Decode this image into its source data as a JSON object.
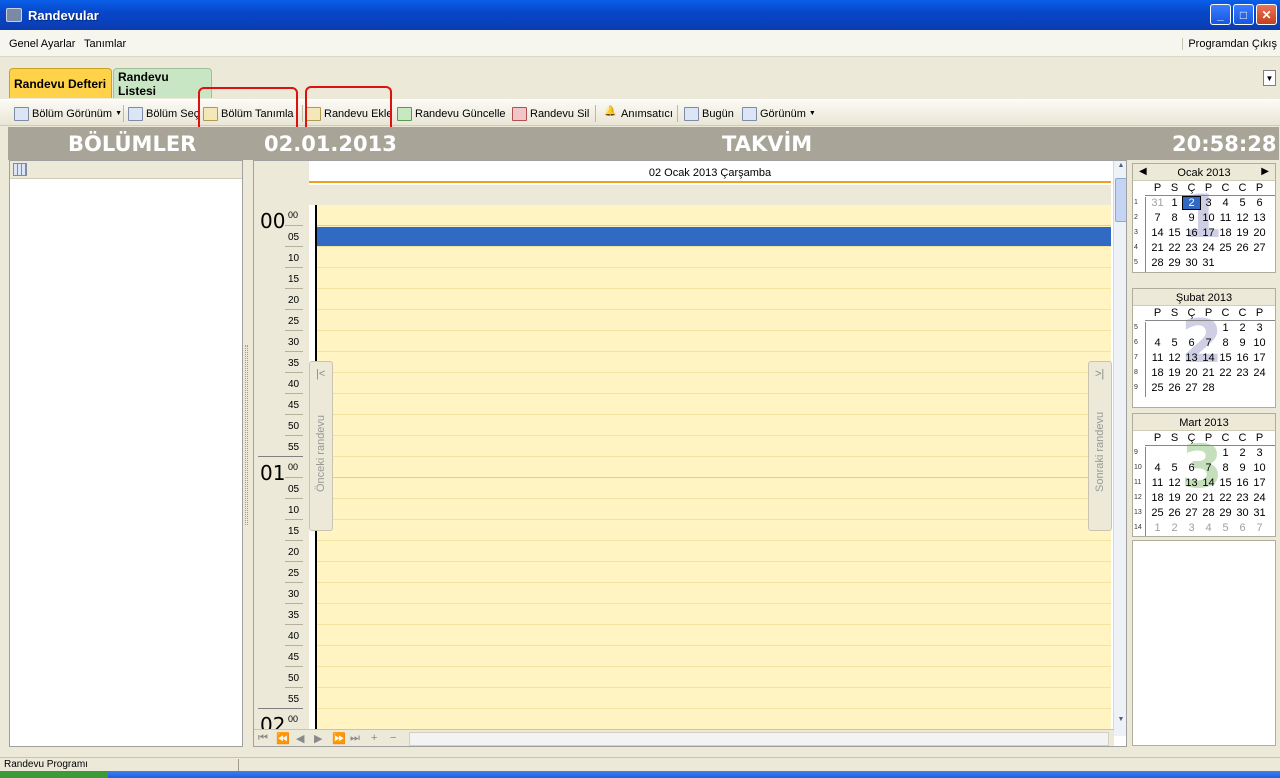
{
  "window": {
    "title": "Randevular"
  },
  "menu": {
    "items": [
      "Genel Ayarlar",
      "Tanımlar"
    ],
    "exit": "Programdan Çıkış"
  },
  "tabs": [
    {
      "label": "Randevu Defteri"
    },
    {
      "label": "Randevu Listesi"
    }
  ],
  "toolbar": {
    "bolum_gorunum": "Bölüm Görünüm",
    "bolum_sec": "Bölüm Seç",
    "bolum_tanimla": "Bölüm Tanımla",
    "randevu_ekle": "Randevu Ekle",
    "randevu_guncelle": "Randevu Güncelle",
    "randevu_sil": "Randevu Sil",
    "animsatici": "Anımsatıcı",
    "bugun": "Bugün",
    "gorunum": "Görünüm"
  },
  "header": {
    "left": "BÖLÜMLER",
    "date": "02.01.2013",
    "center": "TAKVİM",
    "time": "20:58:28"
  },
  "calendar": {
    "day_label": "02 Ocak 2013 Çarşamba",
    "prev_label": "Önceki randevu",
    "next_label": "Sonraki randevu",
    "hours": [
      "00",
      "01",
      "02"
    ],
    "minutes": [
      "00",
      "05",
      "10",
      "15",
      "20",
      "25",
      "30",
      "35",
      "40",
      "45",
      "50",
      "55"
    ]
  },
  "mini_calendars": [
    {
      "title": "Ocak 2013",
      "big": "1",
      "dow": [
        "P",
        "S",
        "Ç",
        "P",
        "C",
        "C",
        "P"
      ],
      "weeks": [
        {
          "wk": "1",
          "days": [
            "31",
            "1",
            "2",
            "3",
            "4",
            "5",
            "6"
          ]
        },
        {
          "wk": "2",
          "days": [
            "7",
            "8",
            "9",
            "10",
            "11",
            "12",
            "13"
          ]
        },
        {
          "wk": "3",
          "days": [
            "14",
            "15",
            "16",
            "17",
            "18",
            "19",
            "20"
          ]
        },
        {
          "wk": "4",
          "days": [
            "21",
            "22",
            "23",
            "24",
            "25",
            "26",
            "27"
          ]
        },
        {
          "wk": "5",
          "days": [
            "28",
            "29",
            "30",
            "31",
            "",
            "",
            ""
          ]
        }
      ]
    },
    {
      "title": "Şubat 2013",
      "big": "2",
      "dow": [
        "P",
        "S",
        "Ç",
        "P",
        "C",
        "C",
        "P"
      ],
      "weeks": [
        {
          "wk": "5",
          "days": [
            "",
            "",
            "",
            "",
            "1",
            "2",
            "3"
          ]
        },
        {
          "wk": "6",
          "days": [
            "4",
            "5",
            "6",
            "7",
            "8",
            "9",
            "10"
          ]
        },
        {
          "wk": "7",
          "days": [
            "11",
            "12",
            "13",
            "14",
            "15",
            "16",
            "17"
          ]
        },
        {
          "wk": "8",
          "days": [
            "18",
            "19",
            "20",
            "21",
            "22",
            "23",
            "24"
          ]
        },
        {
          "wk": "9",
          "days": [
            "25",
            "26",
            "27",
            "28",
            "",
            "",
            ""
          ]
        }
      ]
    },
    {
      "title": "Mart 2013",
      "big": "3",
      "dow": [
        "P",
        "S",
        "Ç",
        "P",
        "C",
        "C",
        "P"
      ],
      "weeks": [
        {
          "wk": "9",
          "days": [
            "",
            "",
            "",
            "",
            "1",
            "2",
            "3"
          ]
        },
        {
          "wk": "10",
          "days": [
            "4",
            "5",
            "6",
            "7",
            "8",
            "9",
            "10"
          ]
        },
        {
          "wk": "11",
          "days": [
            "11",
            "12",
            "13",
            "14",
            "15",
            "16",
            "17"
          ]
        },
        {
          "wk": "12",
          "days": [
            "18",
            "19",
            "20",
            "21",
            "22",
            "23",
            "24"
          ]
        },
        {
          "wk": "13",
          "days": [
            "25",
            "26",
            "27",
            "28",
            "29",
            "30",
            "31"
          ]
        },
        {
          "wk": "14",
          "days": [
            "1",
            "2",
            "3",
            "4",
            "5",
            "6",
            "7"
          ]
        }
      ]
    }
  ],
  "status": {
    "text": "Randevu Programı"
  }
}
